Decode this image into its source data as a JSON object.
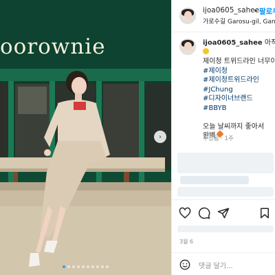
{
  "photo": {
    "sign_text": "oorownie",
    "carousel_next_icon": "chevron-right-icon",
    "carousel_dots": 10,
    "active_dot": 0
  },
  "header": {
    "username": "ijoa0605_sahee",
    "separator": "•",
    "follow_label": "팔로우",
    "location": "가로수길 Garosu-gil, Gangnam"
  },
  "caption": {
    "username": "ijoa0605_sahee",
    "line1_text": "아직 출시",
    "lines": [
      "제이청 트위드라인 너무이"
    ],
    "hashtags": [
      "#제이청",
      "#제이청트위드라인",
      "#JChung",
      "#디자이너브랜드",
      "#BBYB"
    ],
    "closing_line1": "오늘 날씨까지 좋아서",
    "closing_line2": "완벽",
    "meta": "수정됨 · 1주"
  },
  "actions": {
    "like_icon": "heart-icon",
    "comment_icon": "comment-icon",
    "share_icon": "send-icon",
    "save_icon": "bookmark-icon"
  },
  "date": "3월 6",
  "comment": {
    "placeholder": "댓글 달기...",
    "emoji_icon": "smile-icon"
  },
  "colors": {
    "accent": "#0095f6",
    "sign_green": "#0f4a35",
    "hashtag": "#00376b"
  }
}
